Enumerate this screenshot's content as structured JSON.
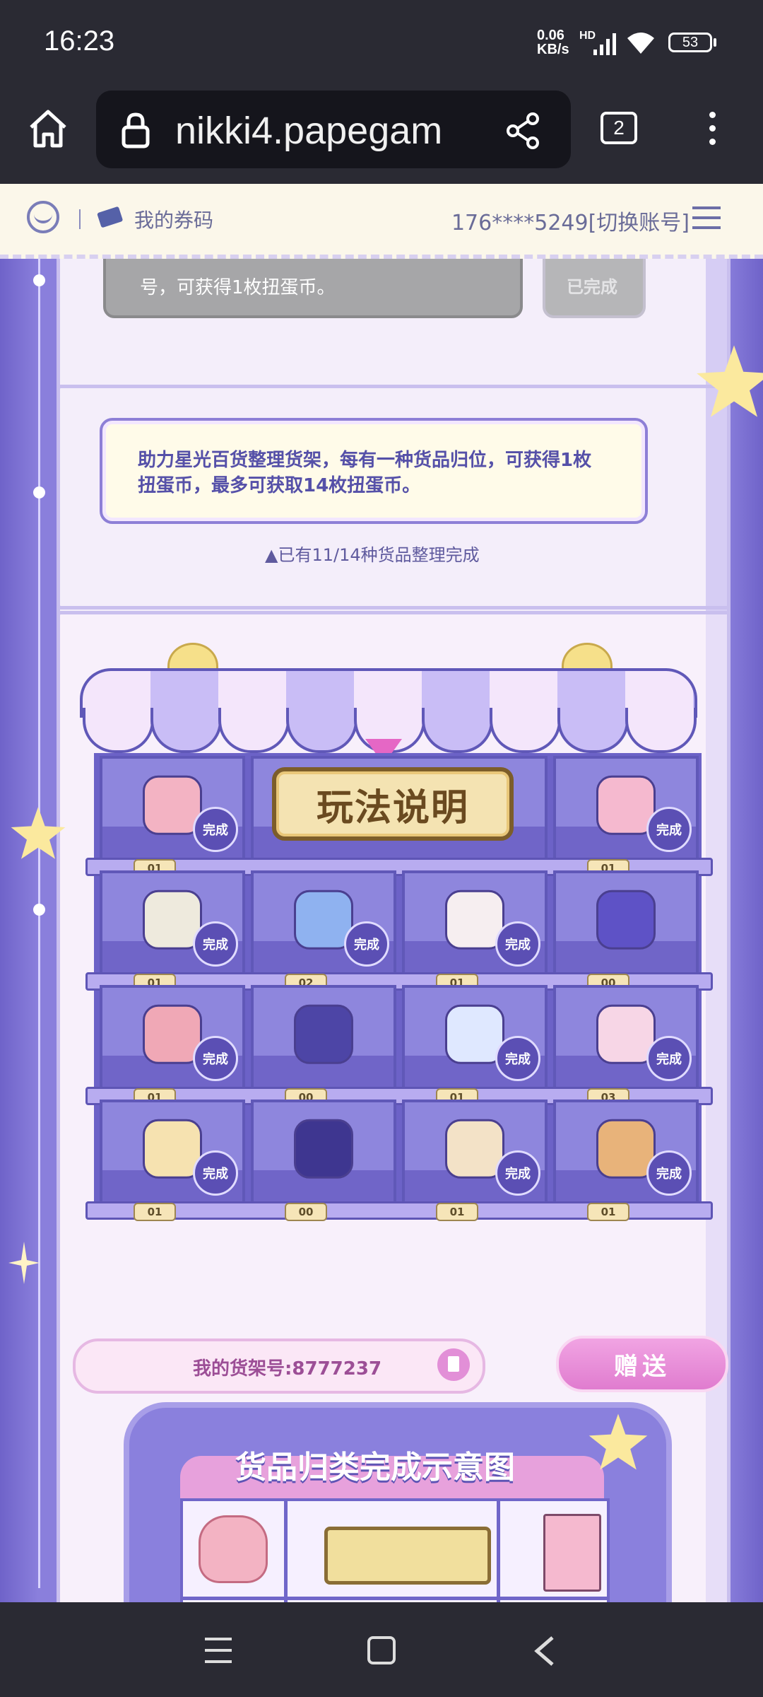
{
  "status_bar": {
    "time": "16:23",
    "net_speed": "0.06",
    "net_unit": "KB/s",
    "network": "HD",
    "battery": "53"
  },
  "browser": {
    "url": "nikki4.papegam",
    "tab_count": "2"
  },
  "site_header": {
    "coupon_label": "我的券码",
    "account": "176****5249[切换账号]"
  },
  "task_prev": {
    "text": "号，可获得1枚扭蛋币。",
    "status": "已完成"
  },
  "task_shelf": {
    "text": "助力星光百货整理货架，每有一种货品归位，可获得1枚扭蛋币，最多可获取14枚扭蛋币。",
    "progress": "▲已有11/14种货品整理完成"
  },
  "shelf": {
    "instruction_label": "玩法说明",
    "done_label": "完成",
    "rows": [
      [
        {
          "item": "backpack",
          "count": "01",
          "done": true
        },
        {
          "item": "instructions",
          "count": "",
          "done": false
        },
        {
          "item": "instructions",
          "count": "",
          "done": false
        },
        {
          "item": "photo-album",
          "count": "01",
          "done": true
        }
      ],
      [
        {
          "item": "flower-basket",
          "count": "01",
          "done": true
        },
        {
          "item": "perfume",
          "count": "02",
          "done": true
        },
        {
          "item": "shell",
          "count": "01",
          "done": true
        },
        {
          "item": "bunny-mug",
          "count": "00",
          "done": false
        }
      ],
      [
        {
          "item": "cat-hat",
          "count": "01",
          "done": true
        },
        {
          "item": "suitcase",
          "count": "00",
          "done": false
        },
        {
          "item": "crystal-ball",
          "count": "01",
          "done": true
        },
        {
          "item": "milk-carton",
          "count": "03",
          "done": true
        }
      ],
      [
        {
          "item": "moon-pillow",
          "count": "01",
          "done": true
        },
        {
          "item": "nikki-box",
          "count": "00",
          "done": false
        },
        {
          "item": "cake",
          "count": "01",
          "done": true
        },
        {
          "item": "camera",
          "count": "01",
          "done": true
        }
      ]
    ]
  },
  "shelf_number": {
    "label": "我的货架号:8777237"
  },
  "gift_button": {
    "label": "赠送"
  },
  "example": {
    "title": "货品归类完成示意图"
  },
  "colors": {
    "accent": "#7a6fd0",
    "text": "#5550a8",
    "badge": "#5b4fb4",
    "gift": "#e58ad6"
  }
}
